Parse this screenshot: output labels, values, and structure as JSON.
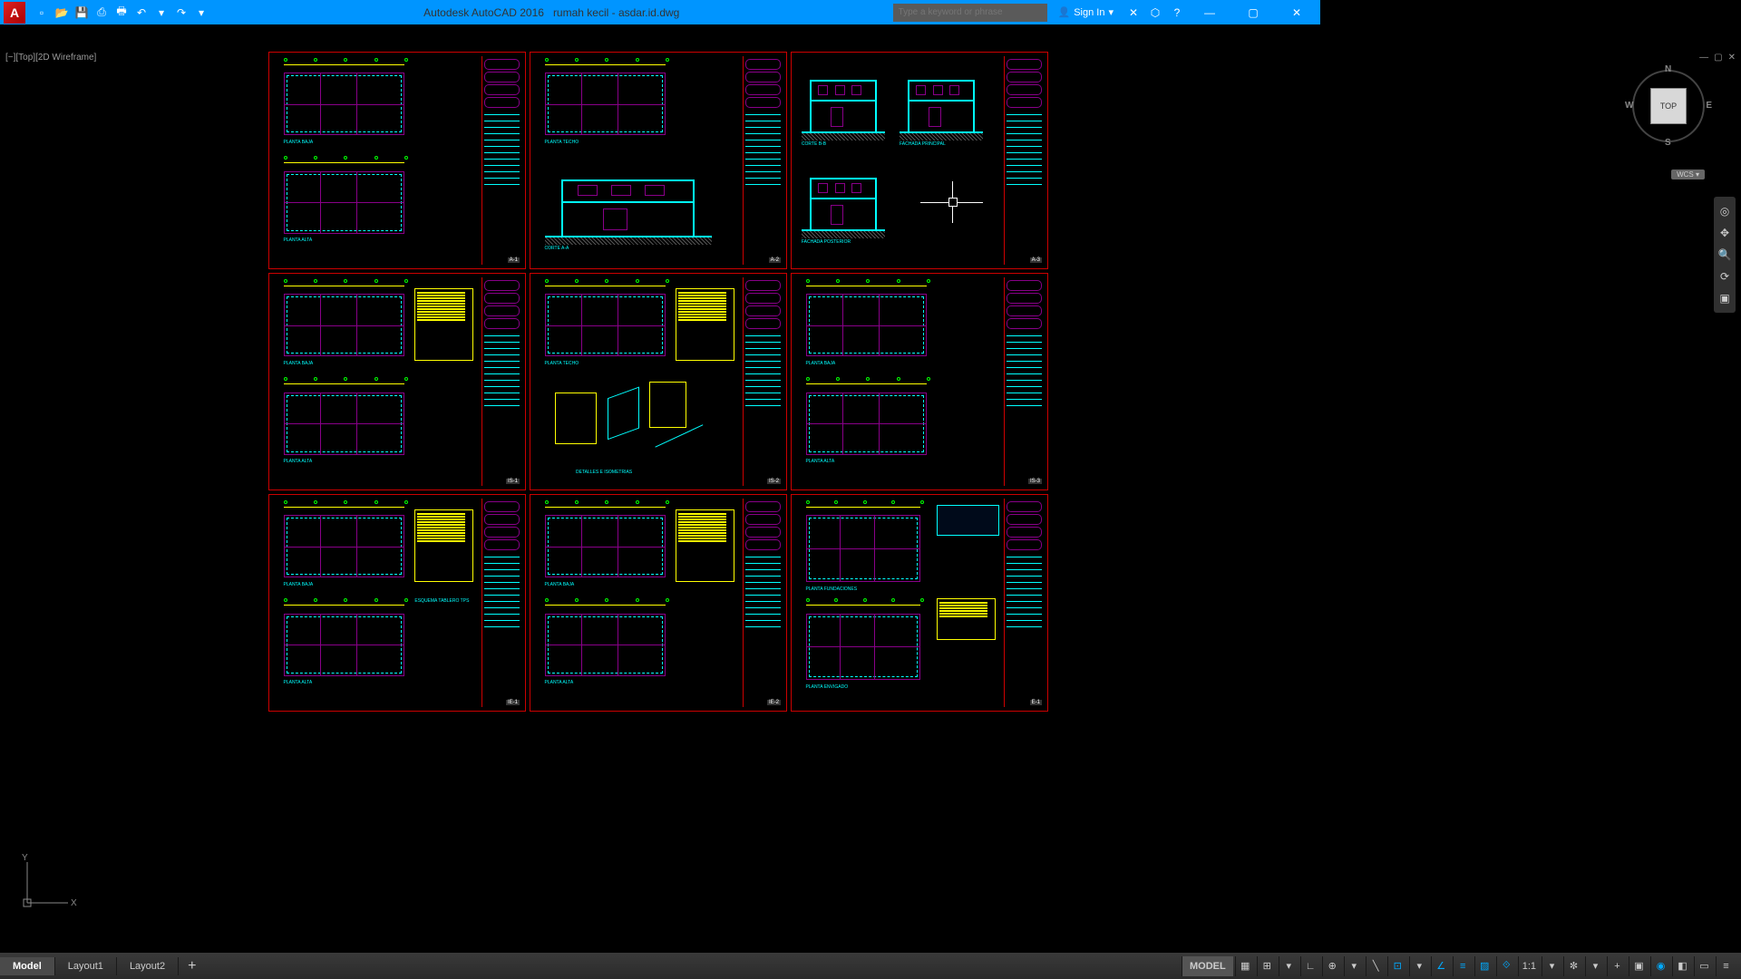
{
  "titlebar": {
    "app": "Autodesk AutoCAD 2016",
    "file": "rumah kecil - asdar.id.dwg",
    "search_placeholder": "Type a keyword or phrase",
    "signin": "Sign In"
  },
  "viewport": {
    "label": "[−][Top][2D Wireframe]"
  },
  "viewcube": {
    "face": "TOP",
    "n": "N",
    "s": "S",
    "e": "E",
    "w": "W",
    "wcs": "WCS"
  },
  "ucs": {
    "x": "X",
    "y": "Y"
  },
  "tabs": {
    "items": [
      "Model",
      "Layout1",
      "Layout2"
    ],
    "active": 0,
    "add": "+"
  },
  "status": {
    "space": "MODEL",
    "scale": "1:1"
  },
  "sheets": [
    {
      "id": "A-1",
      "top": "PLANTA BAJA",
      "bot": "PLANTA ALTA"
    },
    {
      "id": "A-2",
      "top": "PLANTA TECHO",
      "bot": "CORTE A-A"
    },
    {
      "id": "A-3",
      "top": "CORTE B-B",
      "top2": "FACHADA PRINCIPAL",
      "bot": "FACHADA POSTERIOR"
    },
    {
      "id": "IS-1",
      "top": "PLANTA BAJA",
      "bot": "PLANTA ALTA"
    },
    {
      "id": "IS-2",
      "top": "PLANTA TECHO",
      "bot": "DETALLES E ISOMETRIAS"
    },
    {
      "id": "IS-3",
      "top": "PLANTA BAJA",
      "bot": "PLANTA ALTA"
    },
    {
      "id": "IE-1",
      "top": "PLANTA BAJA",
      "bot": "PLANTA ALTA",
      "legend": "ESQUEMA TABLERO TPS"
    },
    {
      "id": "IE-2",
      "top": "PLANTA BAJA",
      "bot": "PLANTA ALTA"
    },
    {
      "id": "E-1",
      "top": "PLANTA FUNDACIONES",
      "bot": "PLANTA ENVIGADO"
    }
  ]
}
